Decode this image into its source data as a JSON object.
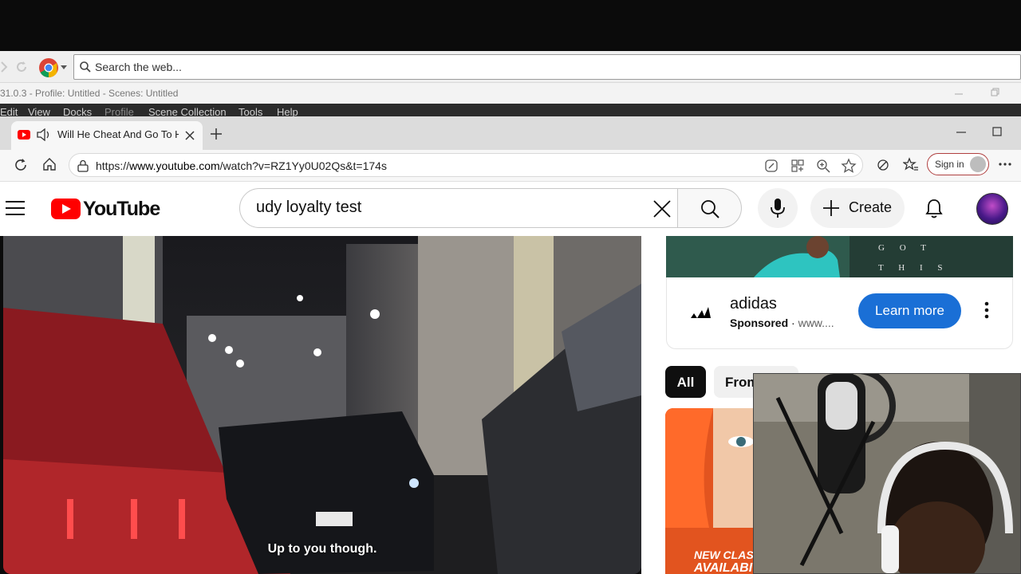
{
  "obs": {
    "search_placeholder": "Search the web...",
    "title": "31.0.3 - Profile: Untitled - Scenes: Untitled",
    "menu": [
      "Edit",
      "View",
      "Docks",
      "Profile",
      "Scene Collection",
      "Tools",
      "Help"
    ]
  },
  "browser": {
    "tab_title": "Will He Cheat And Go To Her",
    "url_prefix": "https://",
    "url_domain": "www.youtube.com",
    "url_path": "/watch?v=RZ1Yy0U02Qs&t=174s",
    "sign_in": "Sign in"
  },
  "youtube": {
    "logo_text": "YouTube",
    "search_query": "udy loyalty test",
    "create_label": "Create"
  },
  "video": {
    "caption": "Up to you though."
  },
  "ad": {
    "banner_text_1": "G O T",
    "banner_text_2": "T H I S",
    "advertiser": "adidas",
    "sponsored": "Sponsored",
    "url": "www....",
    "cta": "Learn more"
  },
  "chips": [
    "All",
    "From"
  ],
  "thumbnail": {
    "line1": "NEW CLASS",
    "line2": "AVAILABI"
  },
  "colors": {
    "yt_red": "#ff0000",
    "cta_blue": "#1a6fd6",
    "obs_dark": "#2b2b2b"
  }
}
